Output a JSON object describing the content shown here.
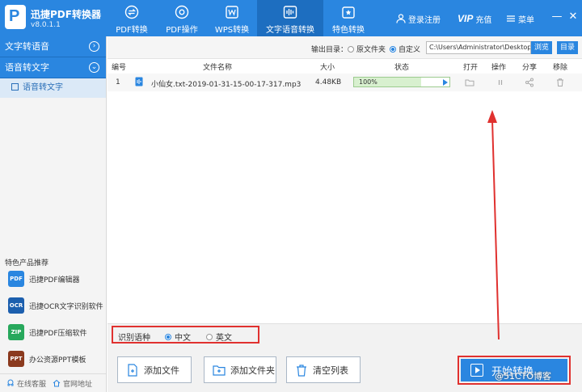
{
  "app": {
    "title": "迅捷PDF转换器",
    "version": "v8.0.1.1",
    "logo_letter": "P"
  },
  "nav": {
    "tabs": [
      {
        "label": "PDF转换",
        "icon": "convert-icon"
      },
      {
        "label": "PDF操作",
        "icon": "gear-icon"
      },
      {
        "label": "WPS转换",
        "icon": "wps-icon"
      },
      {
        "label": "文字语音转换",
        "icon": "audio-wave-icon",
        "active": true
      },
      {
        "label": "特色转换",
        "icon": "star-icon"
      }
    ]
  },
  "header": {
    "login": "登录注册",
    "vip_mark": "VIP",
    "vip_label": "充值",
    "menu": "菜单",
    "minimize": "—",
    "close": "✕"
  },
  "sidebar": {
    "section1": "文字转语音",
    "section2": "语音转文字",
    "sub_item": "语音转文字",
    "rec_title": "特色产品推荐",
    "recs": [
      {
        "label": "迅捷PDF编辑器",
        "icon_text": "PDF"
      },
      {
        "label": "迅捷OCR文字识别软件",
        "icon_text": "OCR"
      },
      {
        "label": "迅捷PDF压缩软件",
        "icon_text": "ZIP"
      },
      {
        "label": "办公资源PPT模板",
        "icon_text": "PPT"
      }
    ],
    "footer": {
      "service": "在线客服",
      "website": "官网地址"
    }
  },
  "toolbar": {
    "output_label": "输出目录：",
    "opt_source": "原文件夹",
    "opt_custom": "自定义",
    "path": "C:\\Users\\Administrator\\Desktop",
    "browse": "浏览",
    "dir": "目录"
  },
  "table": {
    "headers": {
      "no": "编号",
      "name": "文件名称",
      "size": "大小",
      "status": "状态",
      "open": "打开",
      "op": "操作",
      "share": "分享",
      "remove": "移除"
    },
    "rows": [
      {
        "no": "1",
        "name": "小仙女.txt-2019-01-31-15-00-17-317.mp3",
        "size": "4.48KB",
        "progress_text": "100%",
        "progress": 0.7
      }
    ]
  },
  "language": {
    "label": "识别语种",
    "zh": "中文",
    "en": "英文"
  },
  "bottom": {
    "add_file": "添加文件",
    "add_folder": "添加文件夹",
    "clear": "清空列表",
    "start": "开始转换"
  },
  "watermark": "@51CTO博客",
  "colors": {
    "brand": "#2a86e0",
    "annotation": "#e0312f"
  }
}
